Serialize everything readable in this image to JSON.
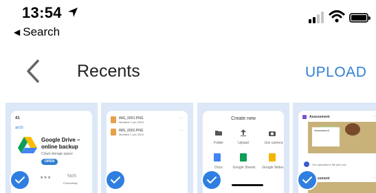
{
  "status_bar": {
    "time": "13:54",
    "back_to": "Search",
    "icons": [
      "location-arrow-icon",
      "signal-bars-icon",
      "wifi-icon",
      "battery-icon"
    ]
  },
  "header": {
    "title": "Recents",
    "upload_label": "UPLOAD",
    "accent": "#2f7fd3"
  },
  "thumbnails": [
    {
      "status_time": "41",
      "search": "arch",
      "app_name": "Google Drive –",
      "app_name_2": "online backup",
      "subtitle": "Cloud storage space",
      "open": "OPEN",
      "rank": "No5",
      "category": "Productivity"
    },
    {
      "file1": "IMG_0001.PNG",
      "file1_meta": "Modified 1 sec 2003",
      "file2": "IMG_0002.PNG",
      "file2_meta": "Modified 1 sec 2003"
    },
    {
      "title": "Create new",
      "items": [
        "Folder",
        "Upload",
        "Use camera",
        "Docs",
        "Google Sheets",
        "Google Slides"
      ]
    },
    {
      "heading1": "Assessment",
      "doc_title": "Assessment",
      "note": "You uploaded a file just now",
      "heading2": "Assessment"
    }
  ],
  "selection_color": "#2f7fe0",
  "thumb_background": "#dce8f7"
}
